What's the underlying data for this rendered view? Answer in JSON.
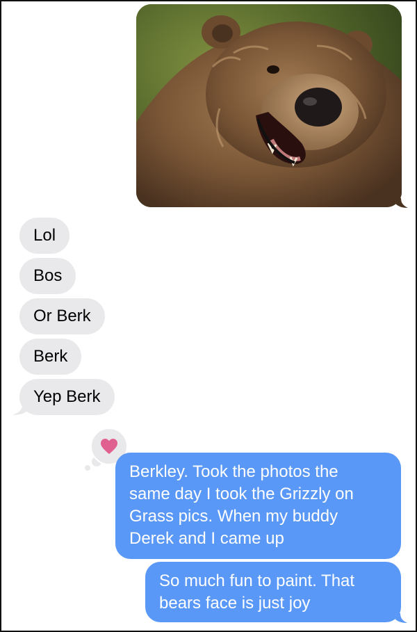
{
  "conversation": {
    "image_message": {
      "subject": "bear painting"
    },
    "incoming": [
      {
        "text": "Lol"
      },
      {
        "text": "Bos"
      },
      {
        "text": "Or Berk"
      },
      {
        "text": "Berk"
      },
      {
        "text": "Yep Berk"
      }
    ],
    "tapback": {
      "icon": "heart-icon",
      "color": "#e0608f"
    },
    "outgoing": [
      {
        "lines": [
          "Berkley. Took the photos the",
          "same day I took the Grizzly on",
          "Grass pics. When my buddy",
          "Derek and I came up"
        ]
      },
      {
        "lines": [
          "So much fun to paint. That",
          "bears face is just joy"
        ]
      }
    ]
  },
  "colors": {
    "incoming_bubble": "#e9e9eb",
    "outgoing_bubble": "#5a98f7",
    "background": "#ffffff"
  }
}
